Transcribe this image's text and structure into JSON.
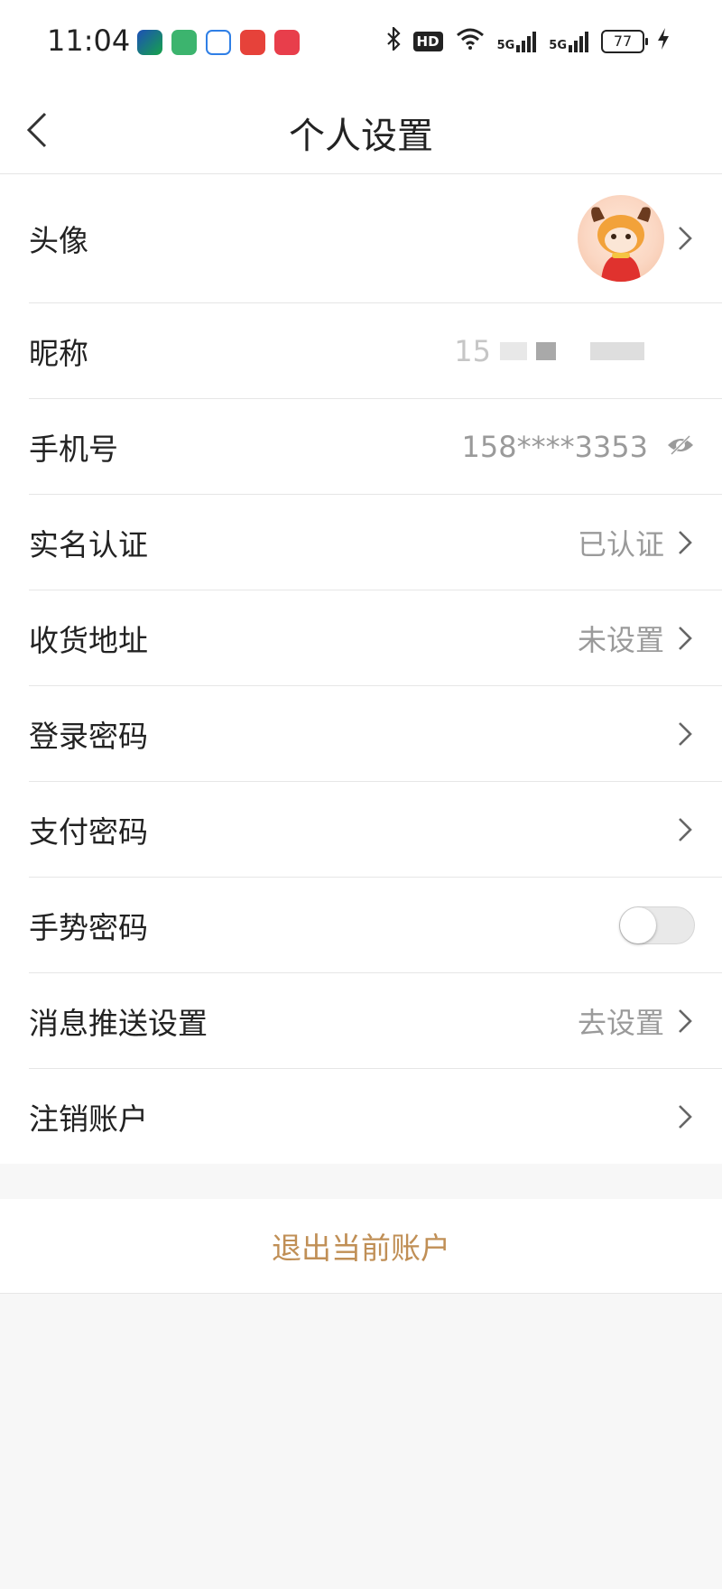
{
  "status_bar": {
    "time": "11:04",
    "battery": "77",
    "signal_label": "5G",
    "hd_label": "HD"
  },
  "header": {
    "title": "个人设置"
  },
  "settings": {
    "avatar": {
      "label": "头像"
    },
    "nickname": {
      "label": "昵称",
      "value": "15"
    },
    "phone": {
      "label": "手机号",
      "value": "158****3353"
    },
    "real_name": {
      "label": "实名认证",
      "value": "已认证"
    },
    "address": {
      "label": "收货地址",
      "value": "未设置"
    },
    "login_password": {
      "label": "登录密码"
    },
    "pay_password": {
      "label": "支付密码"
    },
    "gesture_password": {
      "label": "手势密码",
      "enabled": false
    },
    "push_settings": {
      "label": "消息推送设置",
      "value": "去设置"
    },
    "cancel_account": {
      "label": "注销账户"
    }
  },
  "logout": {
    "label": "退出当前账户"
  },
  "colors": {
    "accent": "#c08f56",
    "secondary_text": "#9a9a9a",
    "background": "#f7f7f7"
  },
  "icons": {
    "back": "chevron-left-icon",
    "row_arrow": "chevron-right-icon",
    "visibility": "eye-off-icon"
  }
}
